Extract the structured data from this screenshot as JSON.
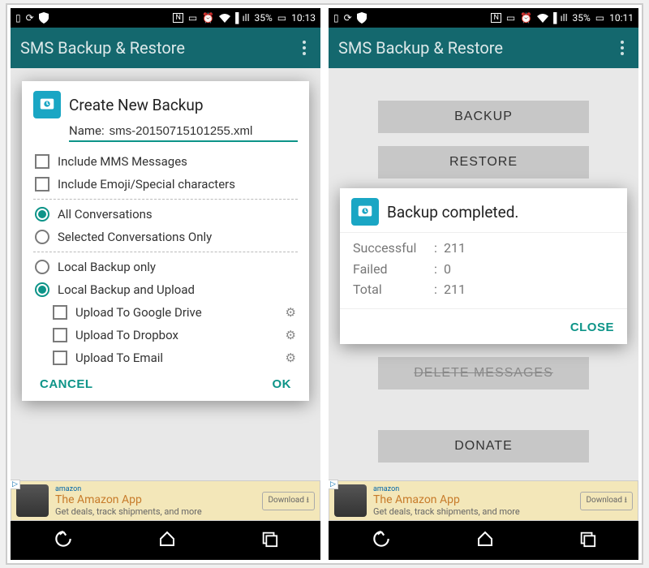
{
  "left": {
    "status": {
      "time": "10:13",
      "battery": "35%"
    },
    "appbar_title": "SMS Backup & Restore",
    "dialog": {
      "title": "Create New Backup",
      "name_label": "Name:",
      "name_value": "sms-20150715101255.xml",
      "include_mms": "Include MMS Messages",
      "include_emoji": "Include Emoji/Special characters",
      "all_conv": "All Conversations",
      "sel_conv": "Selected Conversations Only",
      "local_only": "Local Backup only",
      "local_upload": "Local Backup and Upload",
      "up_gdrive": "Upload To Google Drive",
      "up_dropbox": "Upload To Dropbox",
      "up_email": "Upload To Email",
      "cancel": "CANCEL",
      "ok": "OK"
    },
    "ad": {
      "title": "The Amazon App",
      "sub": "Get deals, track shipments, and more",
      "download": "Download",
      "brand": "amazon"
    }
  },
  "right": {
    "status": {
      "time": "10:11",
      "battery": "35%"
    },
    "appbar_title": "SMS Backup & Restore",
    "buttons": {
      "backup": "BACKUP",
      "restore": "RESTORE",
      "delete_hidden": "DELETE MESSAGES",
      "donate": "DONATE"
    },
    "dialog": {
      "title": "Backup completed.",
      "successful_k": "Successful",
      "successful_v": "211",
      "failed_k": "Failed",
      "failed_v": "0",
      "total_k": "Total",
      "total_v": "211",
      "close": "CLOSE"
    },
    "ad": {
      "title": "The Amazon App",
      "sub": "Get deals, track shipments, and more",
      "download": "Download",
      "brand": "amazon"
    }
  }
}
